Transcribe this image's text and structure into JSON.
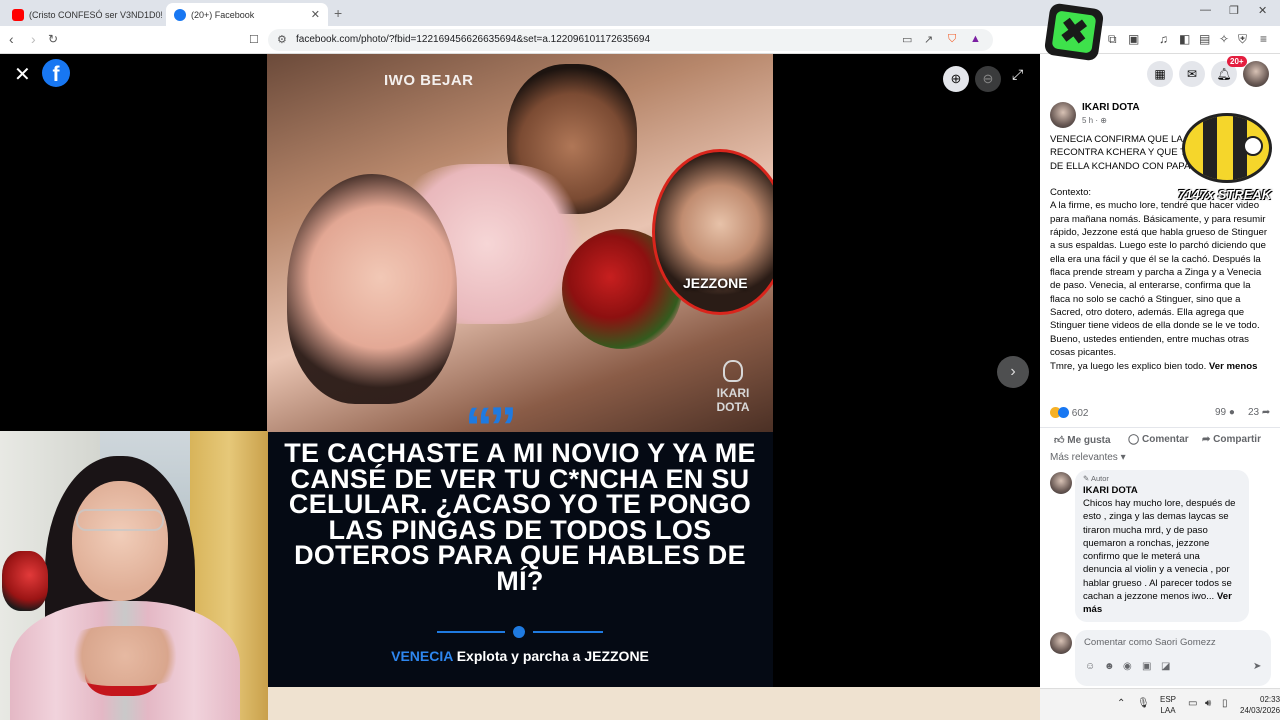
{
  "browser": {
    "tabs": [
      {
        "title": "(Cristo CONFESÓ ser V3ND1D0!"
      },
      {
        "title": "(20+) Facebook"
      }
    ],
    "url": "facebook.com/photo/?fbid=122169456626635694&set=a.122096101172635694"
  },
  "viewer": {
    "photo": {
      "name_tag_top": "IWO BEJAR",
      "name_tag_circle": "JEZZONE",
      "watermark": [
        "IKARI",
        "DOTA"
      ],
      "quote_mark": "“”",
      "headline": "TE CACHASTE A MI NOVIO Y YA ME CANSÉ DE VER TU C*NCHA EN SU CELULAR. ¿ACASO YO TE PONGO LAS PINGAS DE TODOS LOS DOTEROS PARA QUE HABLES DE MÍ?",
      "caption_highlight": "VENECIA",
      "caption_rest": " Explota y parcha a JEZZONE"
    }
  },
  "panel": {
    "notifications_badge": "20+",
    "post": {
      "author": "IKARI DOTA",
      "time": "5 h · ",
      "text_intro": "VENECIA CONFIRMA QUE LA SALIENTE ES RECONTRA KCHERA Y QUE TIENE UN VIDEO DE ELLA KCHANDO CON PAPAYA.",
      "text_context_label": "Contexto:",
      "text_body": "A la firme, es mucho lore, tendré que hacer video para mañana nomás. Básicamente, y para resumir rápido, Jezzone está que habla grueso de Stinguer a sus espaldas. Luego este lo parchó diciendo que ella era una fácil y que él se la cachó. Después la flaca prende stream y parcha a Zinga y a Venecia de paso. Venecia, al enterarse, confirma que la flaca no solo se cachó a Stinguer, sino que a Sacred, otro dotero, además. Ella agrega que Stinguer tiene videos de ella donde se le ve todo. Bueno, ustedes entienden, entre muchas otras cosas picantes.",
      "text_end": "Tmre, ya luego les explico bien todo. ",
      "see_less": "Ver menos",
      "reactions_count": "602",
      "comments_count": "99",
      "shares_count": "23",
      "like_label": "Me gusta",
      "comment_label": "Comentar",
      "share_label": "Compartir"
    },
    "sort_label": "Más relevantes",
    "comment": {
      "badge": "Autor",
      "author": "IKARI DOTA",
      "text": "Chicos hay mucho lore, después de esto , zinga y las demas laycas se tiraron mucha mrd, y de paso quemaron a ronchas, jezzone confirmo que le meterá una denuncia al violin y a venecia , por hablar grueso . Al parecer todos se cachan a jezzone menos iwo... ",
      "see_more": "Ver más"
    },
    "comment_input_placeholder": "Comentar como Saori Gomezz"
  },
  "overlay": {
    "streak_text": "7147x STREAK"
  },
  "taskbar": {
    "lang_line1": "ESP",
    "lang_line2": "LAA",
    "time": "02:33",
    "date": "24/03/2026"
  },
  "colors": {
    "facebook_blue": "#1877f2",
    "accent_blue": "#1f7ae0",
    "circle_red": "#d9251c",
    "badge_red": "#e41e3f"
  }
}
